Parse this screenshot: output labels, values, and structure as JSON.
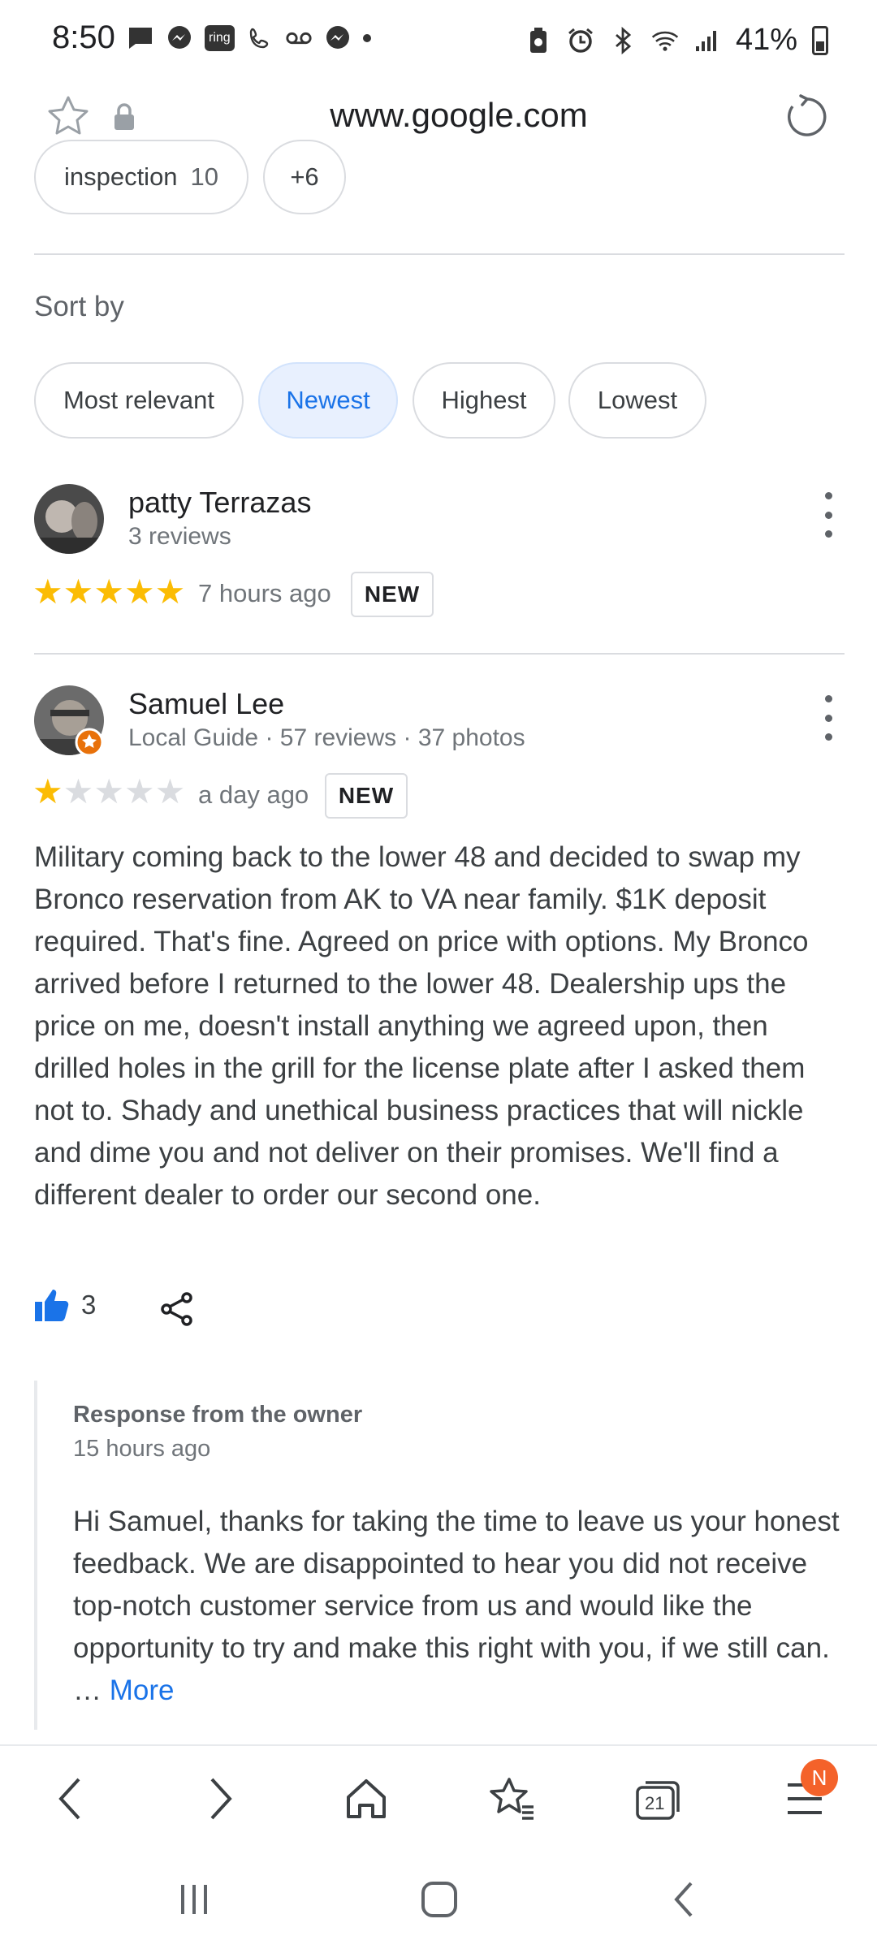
{
  "status_bar": {
    "time": "8:50",
    "ring_label": "ring",
    "battery": "41%"
  },
  "browser": {
    "url": "www.google.com"
  },
  "topics": [
    {
      "label": "inspection",
      "count": "10"
    },
    {
      "label": "+6",
      "count": ""
    }
  ],
  "sort": {
    "label": "Sort by",
    "options": [
      "Most relevant",
      "Newest",
      "Highest",
      "Lowest"
    ],
    "selected": "Newest"
  },
  "reviews": [
    {
      "name": "patty Terrazas",
      "meta": "3 reviews",
      "rating": 5,
      "time": "7 hours ago",
      "badge": "NEW"
    },
    {
      "name": "Samuel Lee",
      "meta": "Local Guide · 57 reviews · 37 photos",
      "rating": 1,
      "time": "a day ago",
      "badge": "NEW",
      "text": "Military coming back to the lower 48 and decided to swap my Bronco reservation from AK to VA near family. $1K deposit required. That's fine. Agreed on price with options. My Bronco arrived before I returned to the lower 48. Dealership ups the price on me, doesn't install anything we agreed upon, then drilled holes in the grill for the license plate after I asked them not to. Shady and unethical business practices that will nickle and dime you and not deliver on their promises.  We'll find a different dealer to order our second one.",
      "likes": "3",
      "owner_response": {
        "title": "Response from the owner",
        "time": "15 hours ago",
        "text": "Hi Samuel, thanks for taking the time to leave us your honest feedback. We are disappointed to hear you did not receive top-notch customer service from us and would like the opportunity to try and make this right with you, if we still can. … ",
        "more": "More"
      }
    }
  ],
  "toolbar": {
    "tab_count": "21",
    "notification": "N"
  },
  "colors": {
    "accent": "#1a73e8",
    "star": "#fbbc04",
    "notification": "#f4622a"
  }
}
